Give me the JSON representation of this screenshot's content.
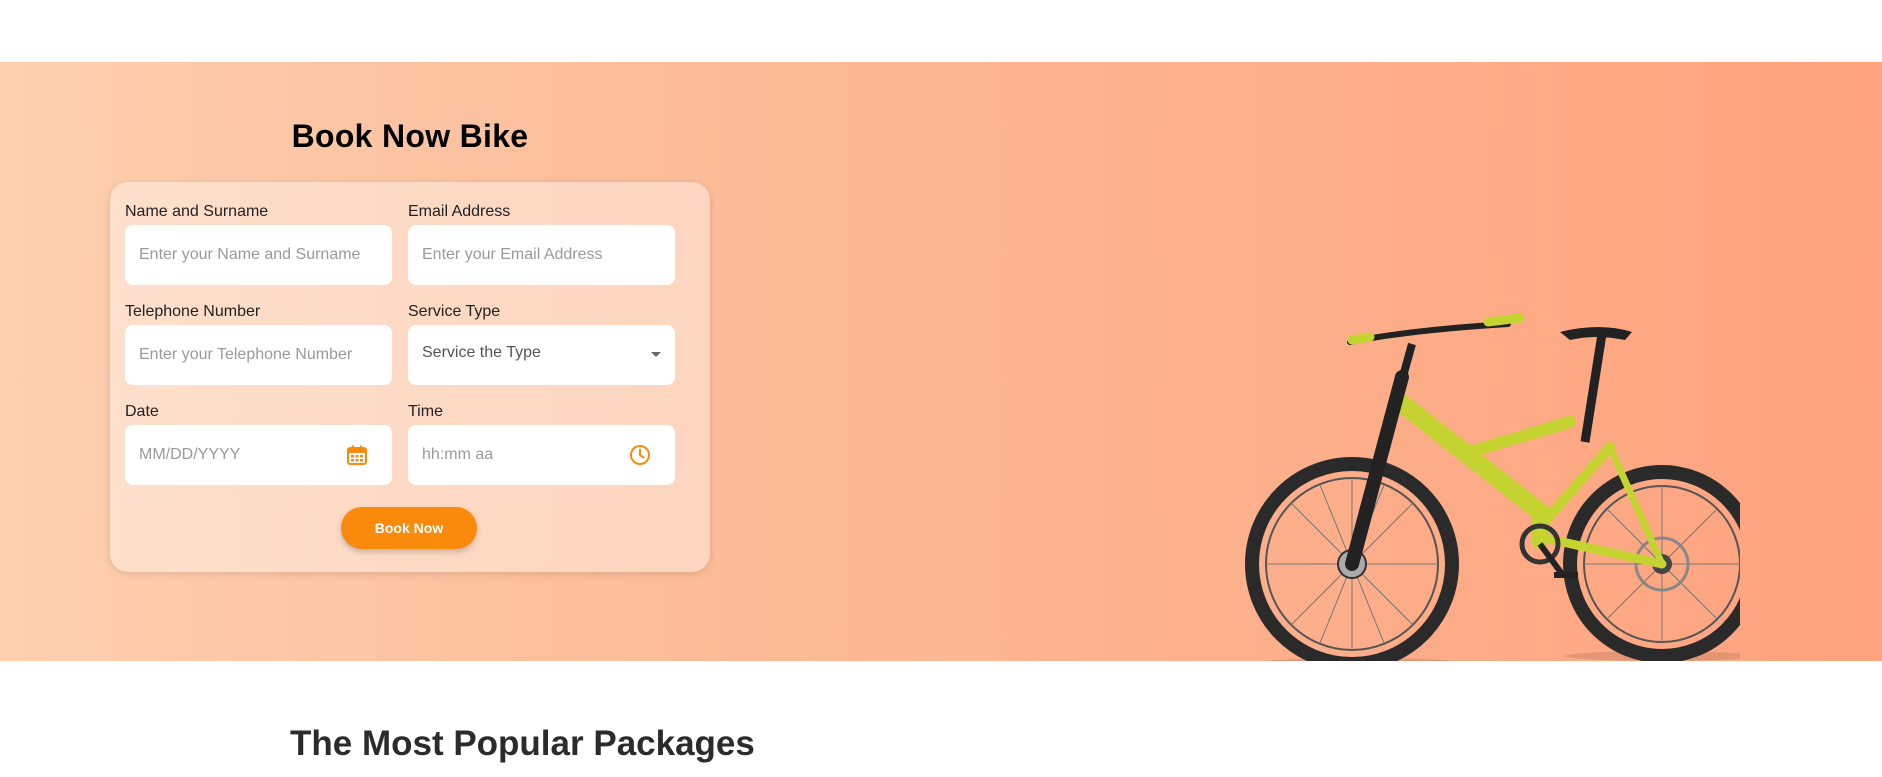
{
  "hero": {
    "title": "Book Now Bike",
    "accent_color": "#f98a0b"
  },
  "form": {
    "name": {
      "label": "Name and Surname",
      "placeholder": "Enter your Name and Surname",
      "value": ""
    },
    "email": {
      "label": "Email Address",
      "placeholder": "Enter your Email Address",
      "value": ""
    },
    "phone": {
      "label": "Telephone Number",
      "placeholder": "Enter your Telephone Number",
      "value": ""
    },
    "service": {
      "label": "Service Type",
      "selected": "Service the Type"
    },
    "date": {
      "label": "Date",
      "placeholder": "MM/DD/YYYY",
      "icon": "calendar-icon"
    },
    "time": {
      "label": "Time",
      "placeholder": "hh:mm aa",
      "icon": "clock-icon"
    },
    "submit_label": "Book Now"
  },
  "packages": {
    "title": "The Most Popular Packages"
  }
}
